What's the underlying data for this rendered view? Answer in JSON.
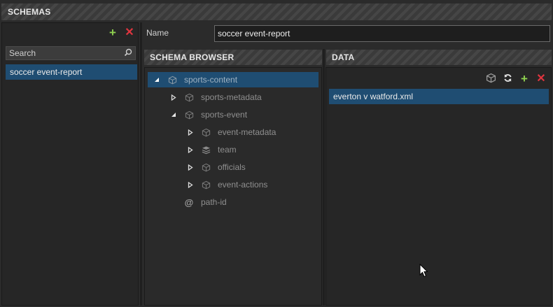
{
  "schemas": {
    "title": "SCHEMAS",
    "add_icon": "plus-icon",
    "remove_icon": "close-icon",
    "search_placeholder": "Search",
    "items": [
      {
        "label": "soccer event-report"
      }
    ]
  },
  "name_field": {
    "label": "Name",
    "value": "soccer event-report"
  },
  "schema_browser": {
    "title": "SCHEMA BROWSER",
    "nodes": [
      {
        "label": "sports-content",
        "icon": "cube-icon",
        "expanded": true,
        "selected": true
      },
      {
        "label": "sports-metadata",
        "icon": "cube-icon",
        "expanded": false
      },
      {
        "label": "sports-event",
        "icon": "cube-icon",
        "expanded": true
      },
      {
        "label": "event-metadata",
        "icon": "cube-icon",
        "expanded": false
      },
      {
        "label": "team",
        "icon": "layers-icon",
        "expanded": false
      },
      {
        "label": "officials",
        "icon": "cube-icon",
        "expanded": false
      },
      {
        "label": "event-actions",
        "icon": "cube-icon",
        "expanded": false
      },
      {
        "label": "path-id",
        "icon": "at-icon"
      }
    ]
  },
  "data_panel": {
    "title": "DATA",
    "toolbar": [
      "cube-icon",
      "refresh-icon",
      "plus-icon",
      "close-icon"
    ],
    "items": [
      {
        "label": "everton v watford.xml"
      }
    ]
  },
  "colors": {
    "selection": "#1f4d72",
    "add": "#8fd14f",
    "remove": "#e0353f",
    "panel": "#262626",
    "header": "#3a3a3a"
  }
}
